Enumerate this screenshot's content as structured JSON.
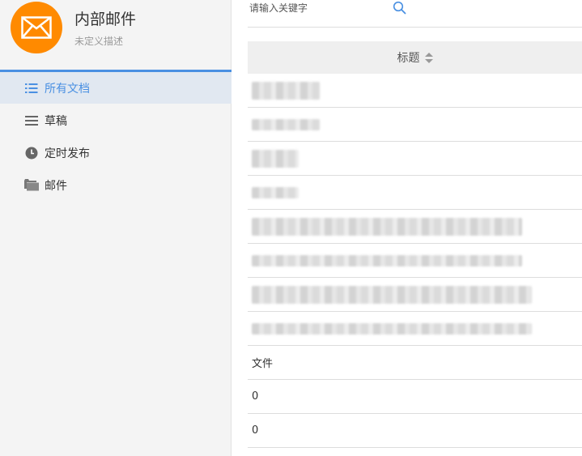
{
  "app": {
    "title": "内部邮件",
    "description": "未定义描述",
    "accent_color": "#4a90e2",
    "logo_color": "#ff8a00",
    "logo_icon": "mail-icon"
  },
  "sidebar": {
    "items": [
      {
        "label": "所有文档",
        "icon": "list-icon",
        "active": true
      },
      {
        "label": "草稿",
        "icon": "menu-icon",
        "active": false
      },
      {
        "label": "定时发布",
        "icon": "clock-icon",
        "active": false
      },
      {
        "label": "邮件",
        "icon": "folder-icon",
        "active": false
      }
    ]
  },
  "search": {
    "placeholder": "请输入关键字",
    "value": "",
    "icon": "search-icon"
  },
  "table": {
    "column_title": "标题",
    "sort_icon": "sort-icon",
    "rows": [
      {
        "title": "",
        "redacted": true
      },
      {
        "title": "",
        "redacted": true
      },
      {
        "title": "",
        "redacted": true
      },
      {
        "title": "",
        "redacted": true
      },
      {
        "title": "",
        "redacted": true
      },
      {
        "title": "",
        "redacted": true
      },
      {
        "title": "",
        "redacted": true
      },
      {
        "title": "",
        "redacted": true
      },
      {
        "title": "文件",
        "redacted": false
      },
      {
        "title": "0",
        "redacted": false
      },
      {
        "title": "0",
        "redacted": false
      }
    ]
  }
}
